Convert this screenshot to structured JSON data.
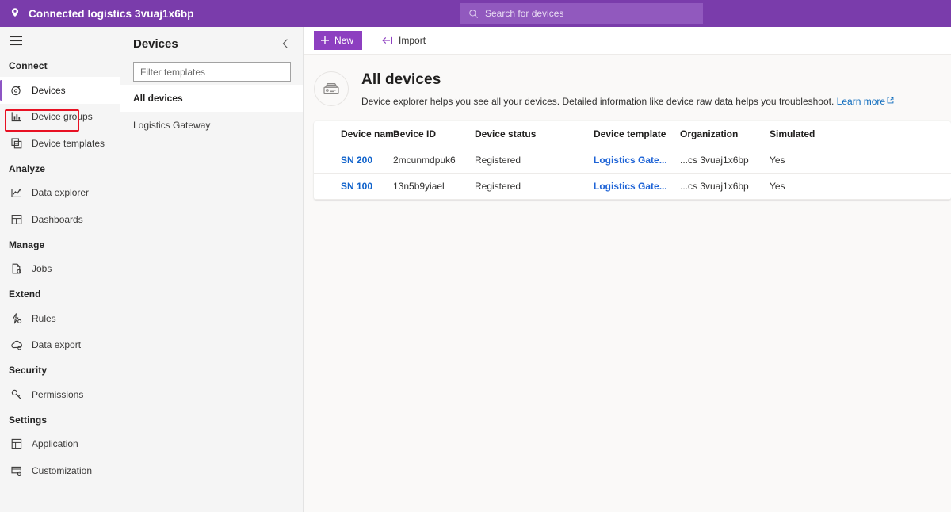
{
  "header": {
    "app_title": "Connected logistics 3vuaj1x6bp",
    "pin_icon": "location-pin-icon",
    "search": {
      "placeholder": "Search for devices",
      "value": "",
      "icon": "search-icon"
    },
    "colors": {
      "bar": "#7a3cab",
      "search_field": "#9159be"
    }
  },
  "sidebar": {
    "menu_icon": "hamburger-menu-icon",
    "accent_color": "#8d55c4",
    "highlight_color": "#e81123",
    "groups": [
      {
        "label": "Connect",
        "items": [
          {
            "label": "Devices",
            "icon": "devices-icon",
            "selected": true
          },
          {
            "label": "Device groups",
            "icon": "device-groups-icon",
            "selected": false
          },
          {
            "label": "Device templates",
            "icon": "device-templates-icon",
            "selected": false
          }
        ]
      },
      {
        "label": "Analyze",
        "items": [
          {
            "label": "Data explorer",
            "icon": "data-explorer-icon",
            "selected": false
          },
          {
            "label": "Dashboards",
            "icon": "dashboards-icon",
            "selected": false
          }
        ]
      },
      {
        "label": "Manage",
        "items": [
          {
            "label": "Jobs",
            "icon": "jobs-icon",
            "selected": false
          }
        ]
      },
      {
        "label": "Extend",
        "items": [
          {
            "label": "Rules",
            "icon": "rules-icon",
            "selected": false
          },
          {
            "label": "Data export",
            "icon": "data-export-icon",
            "selected": false
          }
        ]
      },
      {
        "label": "Security",
        "items": [
          {
            "label": "Permissions",
            "icon": "permissions-key-icon",
            "selected": false
          }
        ]
      },
      {
        "label": "Settings",
        "items": [
          {
            "label": "Application",
            "icon": "application-icon",
            "selected": false
          },
          {
            "label": "Customization",
            "icon": "customization-icon",
            "selected": false
          }
        ]
      }
    ]
  },
  "devices_panel": {
    "title": "Devices",
    "collapse_icon": "chevron-left-icon",
    "filter": {
      "placeholder": "Filter templates",
      "value": ""
    },
    "templates": [
      {
        "label": "All devices",
        "selected": true
      },
      {
        "label": "Logistics Gateway",
        "selected": false
      }
    ]
  },
  "command_bar": {
    "new_label": "New",
    "new_icon": "plus-icon",
    "import_label": "Import",
    "import_icon": "import-arrow-icon",
    "new_button_color": "#8d3fc0"
  },
  "page": {
    "icon": "device-gateway-icon",
    "title": "All devices",
    "description": "Device explorer helps you see all your devices. Detailed information like device raw data helps you troubleshoot.",
    "learn_more_label": "Learn more",
    "learn_more_icon": "external-link-icon",
    "link_color": "#0f6cbd"
  },
  "table": {
    "columns": [
      "Device name",
      "Device ID",
      "Device status",
      "Device template",
      "Organization",
      "Simulated"
    ],
    "rows": [
      {
        "device_name": "SN 200",
        "device_id": "2mcunmdpuk6",
        "device_status": "Registered",
        "device_template": "Logistics Gate...",
        "organization": "...cs 3vuaj1x6bp",
        "simulated": "Yes"
      },
      {
        "device_name": "SN 100",
        "device_id": "13n5b9yiael",
        "device_status": "Registered",
        "device_template": "Logistics Gate...",
        "organization": "...cs 3vuaj1x6bp",
        "simulated": "Yes"
      }
    ]
  }
}
